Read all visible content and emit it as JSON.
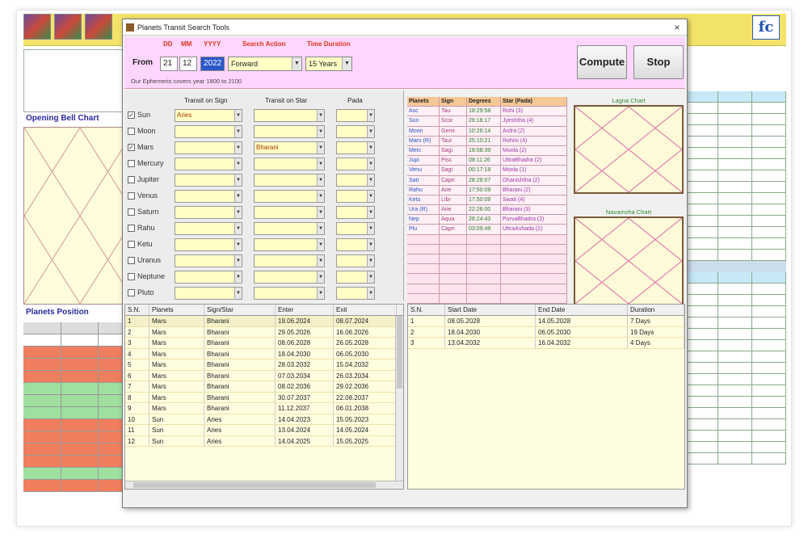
{
  "window": {
    "title": "Planets Transit Search Tools",
    "close_glyph": "×"
  },
  "app": {
    "logo_text": "fc"
  },
  "bg": {
    "opening_title": "Opening Bell Chart",
    "planets_position_title": "Planets Position"
  },
  "search": {
    "label_dd": "DD",
    "label_mm": "MM",
    "label_yyyy": "YYYY",
    "label_action": "Search Action",
    "label_duration": "Time Duration",
    "from_label": "From",
    "dd": "21",
    "mm": "12",
    "yyyy": "2022",
    "action": "Forward",
    "duration": "15 Years",
    "hint": "Our Ephemeris covers year 1800 to 2100"
  },
  "buttons": {
    "compute": "Compute",
    "stop": "Stop"
  },
  "columns": {
    "sign": "Transit on Sign",
    "star": "Transit on Star",
    "pada": "Pada"
  },
  "planets": [
    {
      "name": "Sun",
      "checked": true,
      "sign": "Aries",
      "star": ""
    },
    {
      "name": "Moon",
      "checked": false,
      "sign": "",
      "star": ""
    },
    {
      "name": "Mars",
      "checked": true,
      "sign": "",
      "star": "Bharani"
    },
    {
      "name": "Mercury",
      "checked": false,
      "sign": "",
      "star": ""
    },
    {
      "name": "Jupiter",
      "checked": false,
      "sign": "",
      "star": ""
    },
    {
      "name": "Venus",
      "checked": false,
      "sign": "",
      "star": ""
    },
    {
      "name": "Saturn",
      "checked": false,
      "sign": "",
      "star": ""
    },
    {
      "name": "Rahu",
      "checked": false,
      "sign": "",
      "star": ""
    },
    {
      "name": "Ketu",
      "checked": false,
      "sign": "",
      "star": ""
    },
    {
      "name": "Uranus",
      "checked": false,
      "sign": "",
      "star": ""
    },
    {
      "name": "Neptune",
      "checked": false,
      "sign": "",
      "star": ""
    },
    {
      "name": "Pluto",
      "checked": false,
      "sign": "",
      "star": ""
    }
  ],
  "planet_table": {
    "headers": [
      "Planets",
      "Sign",
      "Degrees",
      "Star (Pada)"
    ],
    "rows": [
      [
        "Asc",
        "Tau",
        "18:29:58",
        "Rohi (3)"
      ],
      [
        "Sun",
        "Scor",
        "26:16:17",
        "Jyeshtha (4)"
      ],
      [
        "Moon",
        "Gemi",
        "10:26:14",
        "Ardra (2)"
      ],
      [
        "Mars (R)",
        "Taur",
        "25:10:21",
        "Rohini (4)"
      ],
      [
        "Merc",
        "Sagi",
        "18:58:39",
        "Moola (2)"
      ],
      [
        "Jupi",
        "Pisc",
        "08:11:26",
        "UttraBhadra (2)"
      ],
      [
        "Venu",
        "Sagi",
        "00:17:18",
        "Moola (1)"
      ],
      [
        "Satr",
        "Capri",
        "28:28:07",
        "Dhanishtha (2)"
      ],
      [
        "Rahu",
        "Arie",
        "17:50:09",
        "Bharani (2)"
      ],
      [
        "Ketu",
        "Libr",
        "17:50:09",
        "Swati (4)"
      ],
      [
        "Ura (R)",
        "Arie",
        "22:26:00",
        "Bharani (3)"
      ],
      [
        "Nep",
        "Aqua",
        "28:24:43",
        "PurvaBhadra (2)"
      ],
      [
        "Plu",
        "Capri",
        "03:09:49",
        "UttraAshada (2)"
      ]
    ]
  },
  "charts": {
    "lagna_title": "Lagna Chart",
    "navamsha_title": "Navamsha Chart"
  },
  "results_left": {
    "headers": [
      "S.N.",
      "Planets",
      "Sign/Star",
      "Enter",
      "Exit"
    ],
    "rows": [
      [
        "1",
        "Mars",
        "Bharani",
        "19.06.2024",
        "08.07.2024"
      ],
      [
        "2",
        "Mars",
        "Bharani",
        "29.05.2026",
        "16.06.2026"
      ],
      [
        "3",
        "Mars",
        "Bharani",
        "08.06.2028",
        "26.05.2028"
      ],
      [
        "4",
        "Mars",
        "Bharani",
        "18.04.2030",
        "06.05.2030"
      ],
      [
        "5",
        "Mars",
        "Bharani",
        "28.03.2032",
        "15.04.2032"
      ],
      [
        "6",
        "Mars",
        "Bharani",
        "07.03.2034",
        "26.03.2034"
      ],
      [
        "7",
        "Mars",
        "Bharani",
        "08.02.2036",
        "29.02.2036"
      ],
      [
        "8",
        "Mars",
        "Bharani",
        "30.07.2037",
        "22.08.2037"
      ],
      [
        "9",
        "Mars",
        "Bharani",
        "11.12.2037",
        "06.01.2038"
      ],
      [
        "10",
        "Sun",
        "Aries",
        "14.04.2023",
        "15.05.2023"
      ],
      [
        "11",
        "Sun",
        "Aries",
        "13.04.2024",
        "14.05.2024"
      ],
      [
        "12",
        "Sun",
        "Aries",
        "14.04.2025",
        "15.05.2025"
      ]
    ]
  },
  "results_right": {
    "headers": [
      "S.N.",
      "Start Date",
      "End Date",
      "Duration"
    ],
    "rows": [
      [
        "1",
        "08.05.2028",
        "14.05.2028",
        "7 Days"
      ],
      [
        "2",
        "18.04.2030",
        "06.05.2030",
        "19 Days"
      ],
      [
        "3",
        "13.04.2032",
        "16.04.2032",
        "4 Days"
      ]
    ]
  },
  "colors": {
    "accent_pink": "#ffd6ff",
    "field_yellow": "#ffffc6",
    "selection_blue": "#2b57c9"
  }
}
